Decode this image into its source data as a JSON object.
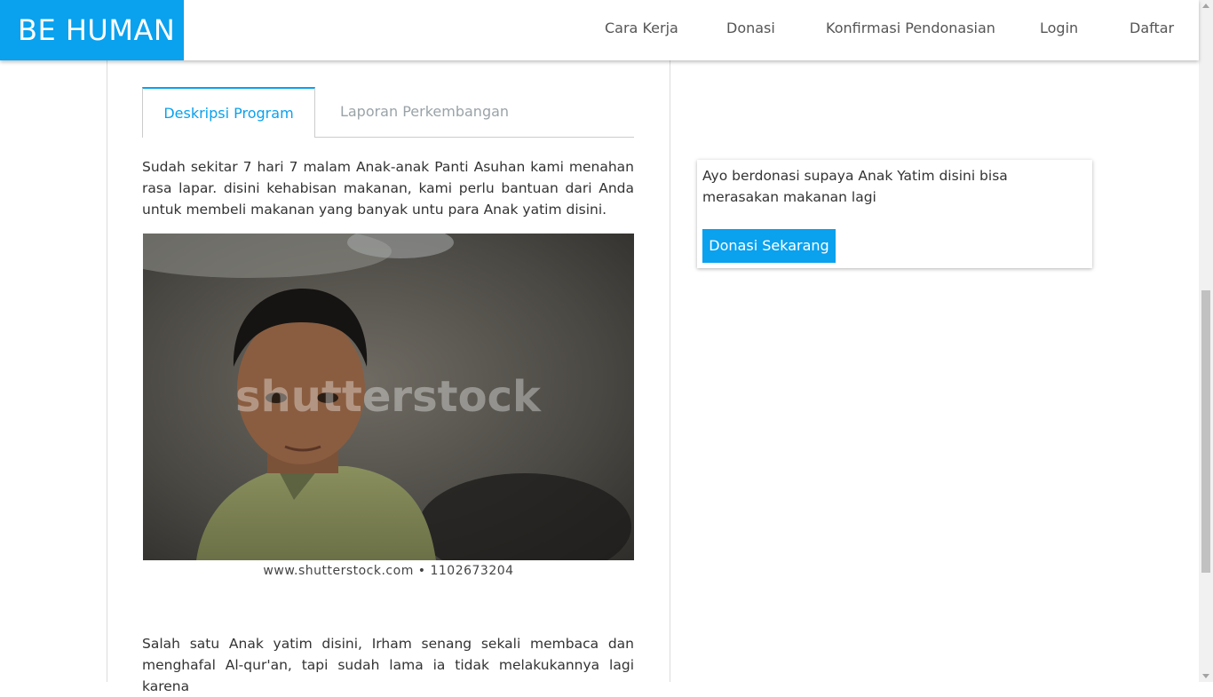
{
  "brand": {
    "title": "BE HUMAN",
    "color": "#0aa1ee"
  },
  "nav": {
    "items": [
      {
        "label": "Cara Kerja"
      },
      {
        "label": "Donasi"
      },
      {
        "label": "Konfirmasi Pendonasian"
      },
      {
        "label": "Login"
      },
      {
        "label": "Daftar"
      }
    ]
  },
  "tabs": [
    {
      "label": "Deskripsi Program",
      "active": true
    },
    {
      "label": "Laporan Perkembangan",
      "active": false
    }
  ],
  "content": {
    "paragraph1": "Sudah sekitar 7 hari 7 malam Anak-anak Panti Asuhan kami menahan rasa lapar. disini kehabisan makanan, kami perlu bantuan dari Anda untuk membeli makanan yang banyak untu para Anak yatim disini.",
    "image": {
      "watermark": "shutterstock",
      "caption": "www.shutterstock.com • 1102673204"
    },
    "paragraph2": "Salah satu Anak yatim disini, Irham senang sekali membaca dan menghafal Al-qur'an, tapi sudah lama ia tidak melakukannya lagi karena"
  },
  "sidebar": {
    "card_text": "Ayo berdonasi supaya Anak Yatim disini bisa merasakan makanan lagi",
    "button_label": "Donasi Sekarang"
  }
}
